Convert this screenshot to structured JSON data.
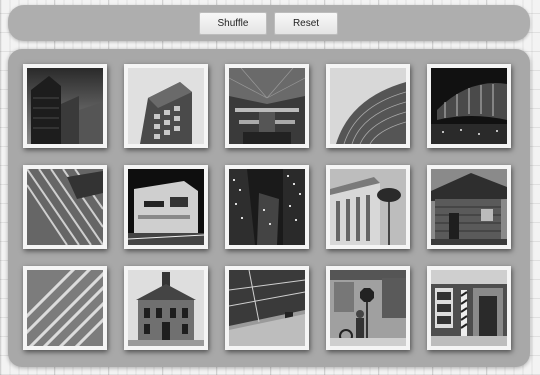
{
  "toolbar": {
    "shuffle_label": "Shuffle",
    "reset_label": "Reset"
  },
  "photos": [
    {
      "name": "tile-tower-dark-sky",
      "icon": "photo-icon"
    },
    {
      "name": "tile-office-block",
      "icon": "photo-icon"
    },
    {
      "name": "tile-atrium-interior",
      "icon": "photo-icon"
    },
    {
      "name": "tile-curved-glass-facade",
      "icon": "photo-icon"
    },
    {
      "name": "tile-night-arena",
      "icon": "photo-icon"
    },
    {
      "name": "tile-diagonal-glass",
      "icon": "photo-icon"
    },
    {
      "name": "tile-night-modern-building",
      "icon": "photo-icon"
    },
    {
      "name": "tile-lit-skyscrapers",
      "icon": "photo-icon"
    },
    {
      "name": "tile-columned-building-palm",
      "icon": "photo-icon"
    },
    {
      "name": "tile-wooden-cabin",
      "icon": "photo-icon"
    },
    {
      "name": "tile-stripe-facade",
      "icon": "photo-icon"
    },
    {
      "name": "tile-brick-house",
      "icon": "photo-icon"
    },
    {
      "name": "tile-underpass-ceiling",
      "icon": "photo-icon"
    },
    {
      "name": "tile-street-stop-sign",
      "icon": "photo-icon"
    },
    {
      "name": "tile-barber-shop",
      "icon": "photo-icon"
    }
  ]
}
